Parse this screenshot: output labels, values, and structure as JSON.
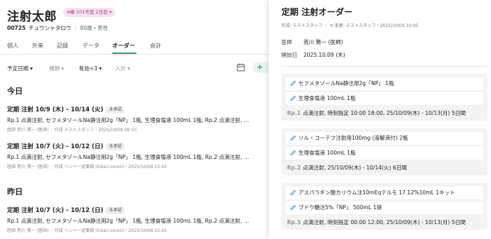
{
  "patient": {
    "name": "注射太郎",
    "ward_badge": "A棟 101号室 2日目",
    "id": "00725",
    "kana": "チュウシャタロウ",
    "age_sex": "80歳・男性"
  },
  "tabs": [
    "個人",
    "外来",
    "記録",
    "データ",
    "オーダー",
    "会計"
  ],
  "active_tab": "オーダー",
  "filters": {
    "sort": "予定日順",
    "kind": "種類",
    "valid": "有効+3",
    "inout": "入外"
  },
  "add_button": "+",
  "sections": [
    {
      "heading": "今日",
      "orders": [
        {
          "title": "定期 注射 10/9 (木) - 10/14 (火)",
          "status": "未承認",
          "detail": "Rp.1 点滴注射, セフメタゾールNa静注用2g「NP」 1瓶, 生理食塩液 100mL 1瓶, Rp.2 点滴注射, …",
          "doctor": "医師 荒川 賢一 (医師)",
          "creator": "作成 テストスタッフ・2025/10/09 08:50"
        },
        {
          "title": "定期 注射 10/7 (火) - 10/12 (日)",
          "status": "未承認",
          "detail": "Rp.1 点滴注射, セフメタゾールNa静注用2g「NP」 1瓶, 生理食塩液 100mL 1瓶, Rp.2 点滴注射, …",
          "doctor": "医師 荒川 賢一 (医師)",
          "creator": "作成 ヘンリー従業員 (hikari.omori)・2025/10/08 23:43"
        }
      ]
    },
    {
      "heading": "昨日",
      "orders": [
        {
          "title": "定期 注射 10/7 (火) - 10/12 (日)",
          "status": "未承認",
          "detail": "Rp.1 点滴注射, セフメタゾールNa静注用2g「NP」 1瓶, 生理食塩液 100mL 1瓶, Rp.2 点滴注射, …",
          "doctor": "医師 荒川 賢一 (医師)",
          "creator": "作成 ヘンリー従業員 (hikari.omori)・2025/10/08 23:43"
        }
      ]
    }
  ],
  "detail": {
    "title": "定期 注射オーダー",
    "created": "作成: テストスタッフ",
    "updated": "変更: テストスタッフ・2025/10/09 10:05",
    "doctor_label": "医師",
    "doctor_value": "荒川 賢一 (医師)",
    "start_label": "開始日",
    "start_value": "2025.10.09 (木)",
    "rps": [
      {
        "drugs": [
          "セフメタゾールNa静注用2g「NP」 1瓶",
          "生理食塩液 100mL 1瓶"
        ],
        "no": "Rp.1",
        "text": "点滴注射, 時刻指定 10:00 18:00, 25/10/09(木) - 10/13(月) 5日間"
      },
      {
        "drugs": [
          "ソル・コーテフ注射用100mg (溶解液付) 2瓶",
          "生理食塩液 100mL 1瓶"
        ],
        "no": "Rp.2",
        "text": "点滴注射, 25/10/09(木) - 10/14(火) 6日間"
      },
      {
        "drugs": [
          "アスパラギン酸カリウム注10mEqテルモ 17.12%10mL 1キット",
          "ブドウ糖注5%「NP」 500mL 1袋"
        ],
        "no": "Rp.3",
        "text": "点滴注射, 時刻指定 00:00 12:00, 25/10/09(木) - 10/13(月) 5日間"
      }
    ]
  },
  "colors": {
    "accent": "#2aa56b",
    "badge_bg": "#f6e2f1",
    "badge_fg": "#b0338f",
    "pen_icon": "#3a8fd6"
  }
}
